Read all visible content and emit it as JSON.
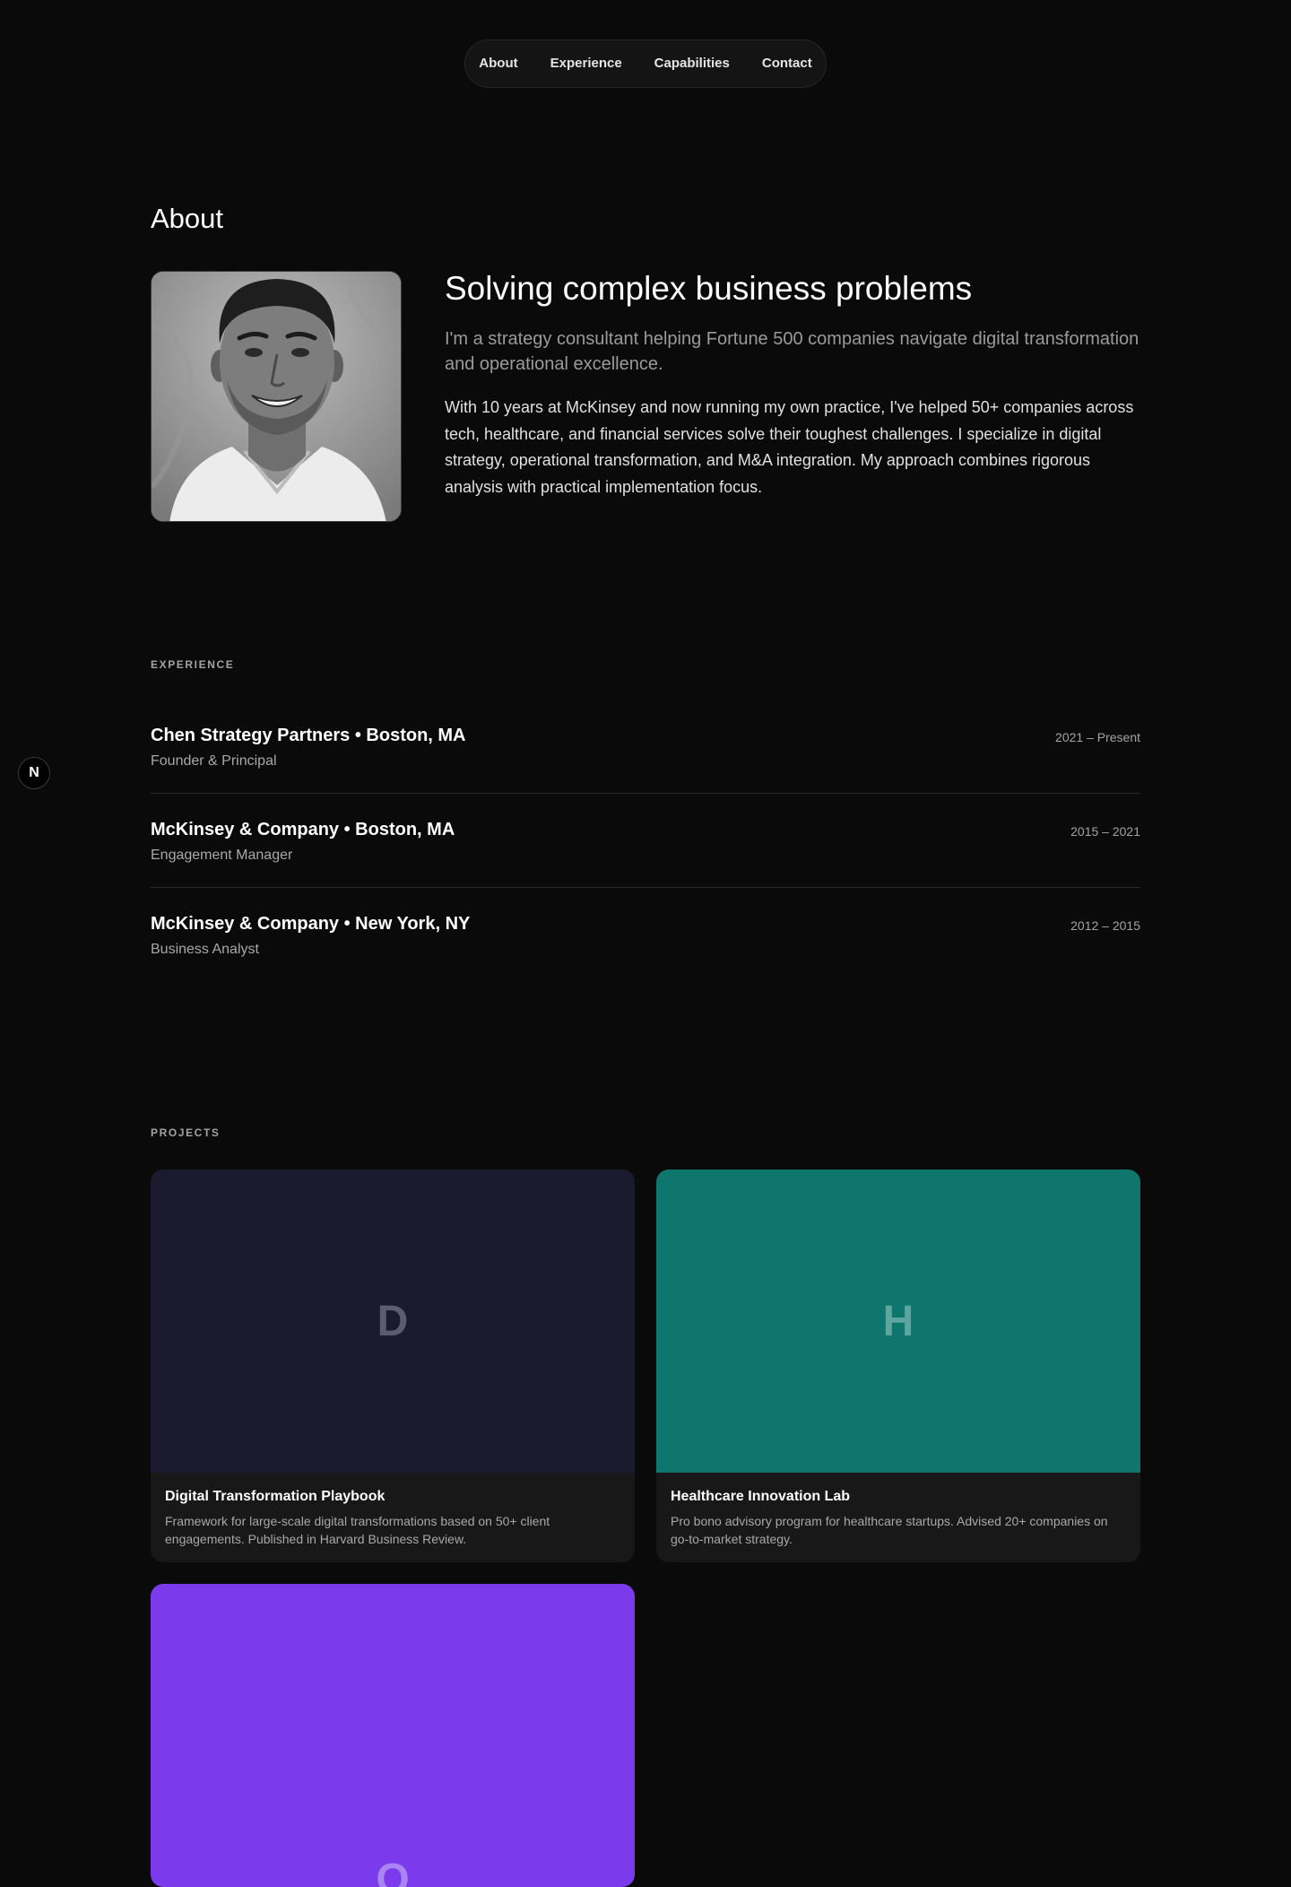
{
  "nav": {
    "items": [
      {
        "label": "About"
      },
      {
        "label": "Experience"
      },
      {
        "label": "Capabilities"
      },
      {
        "label": "Contact"
      }
    ]
  },
  "about": {
    "heading": "About",
    "title": "Solving complex business problems",
    "lead": "I'm a strategy consultant helping Fortune 500 companies navigate digital transformation and operational excellence.",
    "body": "With 10 years at McKinsey and now running my own practice, I've helped 50+ companies across tech, healthcare, and financial services solve their toughest challenges. I specialize in digital strategy, operational transformation, and M&A integration. My approach combines rigorous analysis with practical implementation focus."
  },
  "experience": {
    "label": "EXPERIENCE",
    "items": [
      {
        "company": "Chen Strategy Partners • Boston, MA",
        "role": "Founder & Principal",
        "dates": "2021 – Present"
      },
      {
        "company": "McKinsey & Company • Boston, MA",
        "role": "Engagement Manager",
        "dates": "2015 – 2021"
      },
      {
        "company": "McKinsey & Company • New York, NY",
        "role": "Business Analyst",
        "dates": "2012 – 2015"
      }
    ]
  },
  "projects": {
    "label": "PROJECTS",
    "items": [
      {
        "letter": "D",
        "title": "Digital Transformation Playbook",
        "description": "Framework for large-scale digital transformations based on 50+ client engagements. Published in Harvard Business Review.",
        "color": "#1a1b2e",
        "letter_color": "#5b5c6e"
      },
      {
        "letter": "H",
        "title": "Healthcare Innovation Lab",
        "description": "Pro bono advisory program for healthcare startups. Advised 20+ companies on go-to-market strategy.",
        "color": "#0f766e",
        "letter_color": "#5fa59f"
      },
      {
        "letter": "O",
        "color": "#7c3aed",
        "letter_color": "#a885f0"
      }
    ]
  },
  "badge": {
    "letter": "N"
  }
}
